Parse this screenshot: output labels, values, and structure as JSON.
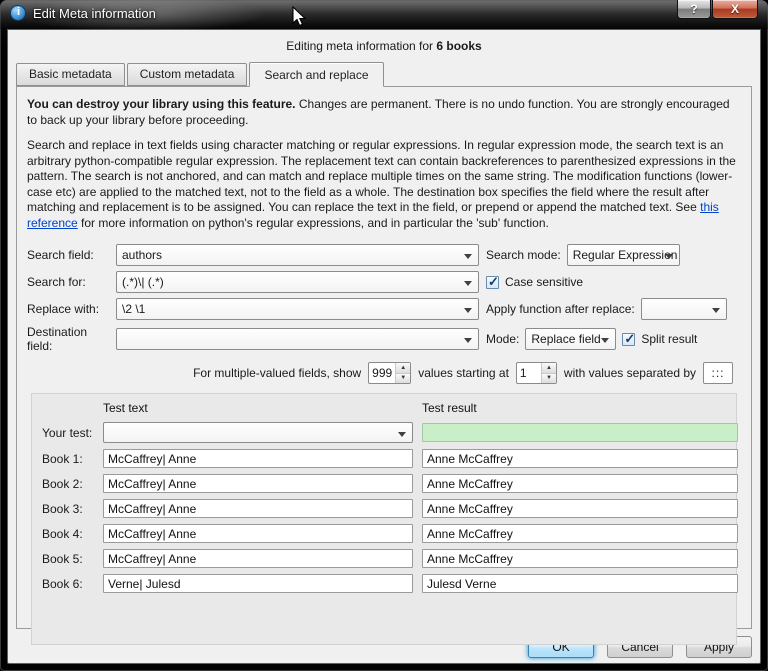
{
  "window": {
    "title": "Edit Meta information",
    "help_button": "?",
    "close_button": "X"
  },
  "header": {
    "prefix": "Editing meta information for ",
    "emphasis": "6 books"
  },
  "tabs": [
    {
      "label": "Basic metadata",
      "active": false
    },
    {
      "label": "Custom metadata",
      "active": false
    },
    {
      "label": "Search and replace",
      "active": true
    }
  ],
  "warning": {
    "bold": "You can destroy your library using this feature.",
    "rest": " Changes are permanent. There is no undo function. You are strongly encouraged to back up your library before proceeding."
  },
  "description": {
    "part1": "Search and replace in text fields using character matching or regular expressions. In regular expression mode, the search text is an arbitrary python-compatible regular expression. The replacement text can contain backreferences to parenthesized expressions in the pattern. The search is not anchored, and can match and replace multiple times on the same string. The modification functions (lower-case etc) are applied to the matched text, not to the field as a whole. The destination box specifies the field where the result after matching and replacement is to be assigned. You can replace the text in the field, or prepend or append the matched text. See ",
    "link": "this reference",
    "part2": " for more information on python's regular expressions, and in particular the 'sub' function."
  },
  "form": {
    "search_field_label": "Search field:",
    "search_field_value": "authors",
    "search_mode_label": "Search mode:",
    "search_mode_value": "Regular Expression",
    "search_for_label": "Search for:",
    "search_for_value": "(.*)\\| (.*)",
    "case_sensitive_label": "Case sensitive",
    "case_sensitive_checked": true,
    "replace_with_label": "Replace with:",
    "replace_with_value": "\\2 \\1",
    "apply_function_label": "Apply function after replace:",
    "apply_function_value": "",
    "destination_label": "Destination field:",
    "destination_value": "",
    "mode_label": "Mode:",
    "mode_value": "Replace field",
    "split_result_label": "Split result",
    "split_result_checked": true,
    "multi": {
      "text1": "For multiple-valued fields, show",
      "count": "999",
      "text2": "values starting at",
      "start": "1",
      "text3": "with values separated by",
      "separator": ":::"
    }
  },
  "test": {
    "col_text_header": "Test text",
    "col_result_header": "Test result",
    "your_test_label": "Your test:",
    "your_test_value": "",
    "your_test_result": "",
    "rows": [
      {
        "label": "Book 1:",
        "text": "McCaffrey| Anne",
        "result": "Anne McCaffrey"
      },
      {
        "label": "Book 2:",
        "text": "McCaffrey| Anne",
        "result": "Anne McCaffrey"
      },
      {
        "label": "Book 3:",
        "text": "McCaffrey| Anne",
        "result": "Anne McCaffrey"
      },
      {
        "label": "Book 4:",
        "text": "McCaffrey| Anne",
        "result": "Anne McCaffrey"
      },
      {
        "label": "Book 5:",
        "text": "McCaffrey| Anne",
        "result": "Anne McCaffrey"
      },
      {
        "label": "Book 6:",
        "text": "Verne| Julesd",
        "result": "Julesd Verne"
      }
    ]
  },
  "buttons": {
    "ok": "OK",
    "cancel": "Cancel",
    "apply": "Apply"
  },
  "colors": {
    "result_success_bg": "#c8efc8",
    "link": "#0044cc",
    "close_button_red": "#a93a20"
  }
}
